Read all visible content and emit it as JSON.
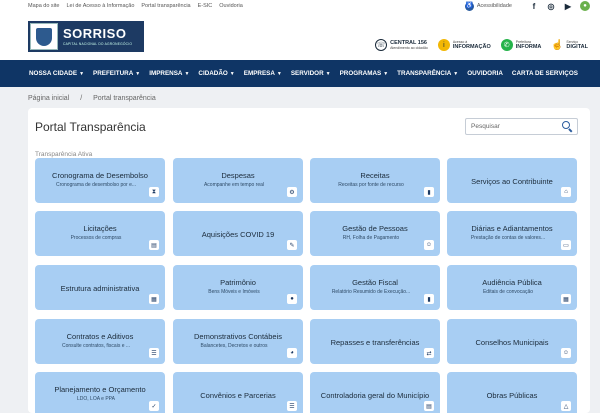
{
  "topbar": {
    "links": [
      "Mapa do site",
      "Lei de Acesso à Informação",
      "Portal transparência",
      "E-SIC",
      "Ouvidoria"
    ],
    "accessibility": "Acessibilidade"
  },
  "header": {
    "logo_name": "SORRISO",
    "logo_sub": "CAPITAL NACIONAL DO AGRONEGÓCIO",
    "links": [
      {
        "icon": "phone-icon",
        "line1": "CENTRAL 156",
        "line2": "Atendimento ao cidadão",
        "color": "#ffffff"
      },
      {
        "icon": "info-icon",
        "line1": "Acesso à",
        "line2": "INFORMAÇÃO",
        "color": "#f2b705"
      },
      {
        "icon": "whatsapp-icon",
        "line1": "Prefeitura",
        "line2": "INFORMA",
        "color": "#25b34a"
      },
      {
        "icon": "digital-service-icon",
        "line1": "Serviço",
        "line2": "DIGITAL",
        "color": "#ffffff"
      }
    ]
  },
  "nav": {
    "items": [
      {
        "label": "NOSSA CIDADE",
        "dropdown": true
      },
      {
        "label": "PREFEITURA",
        "dropdown": true
      },
      {
        "label": "IMPRENSA",
        "dropdown": true
      },
      {
        "label": "CIDADÃO",
        "dropdown": true
      },
      {
        "label": "EMPRESA",
        "dropdown": true
      },
      {
        "label": "SERVIDOR",
        "dropdown": true
      },
      {
        "label": "PROGRAMAS",
        "dropdown": true
      },
      {
        "label": "TRANSPARÊNCIA",
        "dropdown": true
      },
      {
        "label": "OUVIDORIA",
        "dropdown": false
      },
      {
        "label": "CARTA DE SERVIÇOS",
        "dropdown": false
      }
    ]
  },
  "breadcrumb": {
    "home": "Página inicial",
    "separator": "/",
    "current": "Portal transparência"
  },
  "main": {
    "title": "Portal Transparência",
    "search_placeholder": "Pesquisar",
    "section_label": "Transparência Ativa",
    "tiles": [
      {
        "title": "Cronograma de Desembolso",
        "subtitle": "Cronograma de desembolso por e...",
        "icon": "hourglass-icon"
      },
      {
        "title": "Despesas",
        "subtitle": "Acompanhe em tempo real",
        "icon": "expenses-icon"
      },
      {
        "title": "Receitas",
        "subtitle": "Receitas por fonte de recurso",
        "icon": "chart-bars-icon"
      },
      {
        "title": "Serviços ao Contribuinte",
        "subtitle": "",
        "icon": "building-icon"
      },
      {
        "title": "Licitações",
        "subtitle": "Processos de compras",
        "icon": "clipboard-icon"
      },
      {
        "title": "Aquisições COVID 19",
        "subtitle": "",
        "icon": "syringe-icon"
      },
      {
        "title": "Gestão de Pessoas",
        "subtitle": "RH, Folha de Pagamento",
        "icon": "people-icon"
      },
      {
        "title": "Diárias e Adiantamentos",
        "subtitle": "Prestação de contas de valores...",
        "icon": "money-icon"
      },
      {
        "title": "Estrutura administrativa",
        "subtitle": "",
        "icon": "org-chart-icon"
      },
      {
        "title": "Patrimônio",
        "subtitle": "Bens Móveis e Imóveis",
        "icon": "microphone-icon"
      },
      {
        "title": "Gestão Fiscal",
        "subtitle": "Relatório Resumido de Execução...",
        "icon": "bar-chart-icon"
      },
      {
        "title": "Audiência Pública",
        "subtitle": "Editais de convocação",
        "icon": "calendar-icon"
      },
      {
        "title": "Contratos e Aditivos",
        "subtitle": "Consulte contratos, fiscais e ...",
        "icon": "list-icon"
      },
      {
        "title": "Demonstrativos Contábeis",
        "subtitle": "Balancetes, Decretos e outros",
        "icon": "pie-chart-icon"
      },
      {
        "title": "Repasses e transferências",
        "subtitle": "",
        "icon": "transfer-icon"
      },
      {
        "title": "Conselhos Municipais",
        "subtitle": "",
        "icon": "group-icon"
      },
      {
        "title": "Planejamento e Orçamento",
        "subtitle": "LDO, LOA e PPA",
        "icon": "planning-icon"
      },
      {
        "title": "Convênios e Parcerias",
        "subtitle": "",
        "icon": "list-icon"
      },
      {
        "title": "Controladoria geral do Município",
        "subtitle": "",
        "icon": "report-icon"
      },
      {
        "title": "Obras Públicas",
        "subtitle": "",
        "icon": "warning-icon"
      }
    ]
  }
}
